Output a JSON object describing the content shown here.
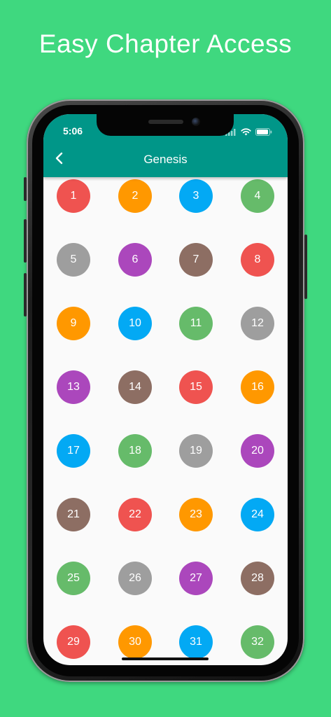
{
  "headline": "Easy Chapter Access",
  "status_bar": {
    "time": "5:06",
    "icons": [
      "signal-icon",
      "wifi-icon",
      "battery-icon"
    ]
  },
  "app_bar": {
    "title": "Genesis",
    "back_icon": "chevron-left-icon"
  },
  "colors": {
    "background": "#3fd87f",
    "app_bar": "#009688",
    "red": "#ef5350",
    "orange": "#ff9800",
    "blue": "#03a9f4",
    "green": "#66bb6a",
    "grey": "#9e9e9e",
    "purple": "#ab47bc",
    "brown": "#8d6e63"
  },
  "chapters": [
    {
      "label": "1",
      "color": "#ef5350"
    },
    {
      "label": "2",
      "color": "#ff9800"
    },
    {
      "label": "3",
      "color": "#03a9f4"
    },
    {
      "label": "4",
      "color": "#66bb6a"
    },
    {
      "label": "5",
      "color": "#9e9e9e"
    },
    {
      "label": "6",
      "color": "#ab47bc"
    },
    {
      "label": "7",
      "color": "#8d6e63"
    },
    {
      "label": "8",
      "color": "#ef5350"
    },
    {
      "label": "9",
      "color": "#ff9800"
    },
    {
      "label": "10",
      "color": "#03a9f4"
    },
    {
      "label": "11",
      "color": "#66bb6a"
    },
    {
      "label": "12",
      "color": "#9e9e9e"
    },
    {
      "label": "13",
      "color": "#ab47bc"
    },
    {
      "label": "14",
      "color": "#8d6e63"
    },
    {
      "label": "15",
      "color": "#ef5350"
    },
    {
      "label": "16",
      "color": "#ff9800"
    },
    {
      "label": "17",
      "color": "#03a9f4"
    },
    {
      "label": "18",
      "color": "#66bb6a"
    },
    {
      "label": "19",
      "color": "#9e9e9e"
    },
    {
      "label": "20",
      "color": "#ab47bc"
    },
    {
      "label": "21",
      "color": "#8d6e63"
    },
    {
      "label": "22",
      "color": "#ef5350"
    },
    {
      "label": "23",
      "color": "#ff9800"
    },
    {
      "label": "24",
      "color": "#03a9f4"
    },
    {
      "label": "25",
      "color": "#66bb6a"
    },
    {
      "label": "26",
      "color": "#9e9e9e"
    },
    {
      "label": "27",
      "color": "#ab47bc"
    },
    {
      "label": "28",
      "color": "#8d6e63"
    },
    {
      "label": "29",
      "color": "#ef5350"
    },
    {
      "label": "30",
      "color": "#ff9800"
    },
    {
      "label": "31",
      "color": "#03a9f4"
    },
    {
      "label": "32",
      "color": "#66bb6a"
    }
  ]
}
